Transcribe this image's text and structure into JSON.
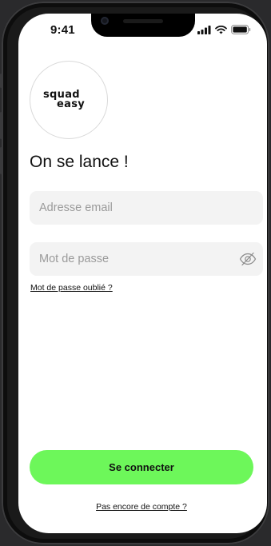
{
  "status_bar": {
    "time": "9:41",
    "icons": [
      "signal-bars-icon",
      "wifi-icon",
      "battery-icon"
    ]
  },
  "logo": {
    "line1": "squad",
    "line2": "easy"
  },
  "login": {
    "title": "On se lance !",
    "email_placeholder": "Adresse email",
    "password_placeholder": "Mot de passe",
    "forgot_password": "Mot de passe oublié ?",
    "submit_label": "Se connecter",
    "signup_link": "Pas encore de compte ?"
  },
  "colors": {
    "accent": "#6df75a",
    "input_background": "#f3f3f3",
    "placeholder": "#9a9a9a",
    "text": "#111111",
    "device_frame": "#1a1a1a",
    "background": "#2a2a2c"
  }
}
